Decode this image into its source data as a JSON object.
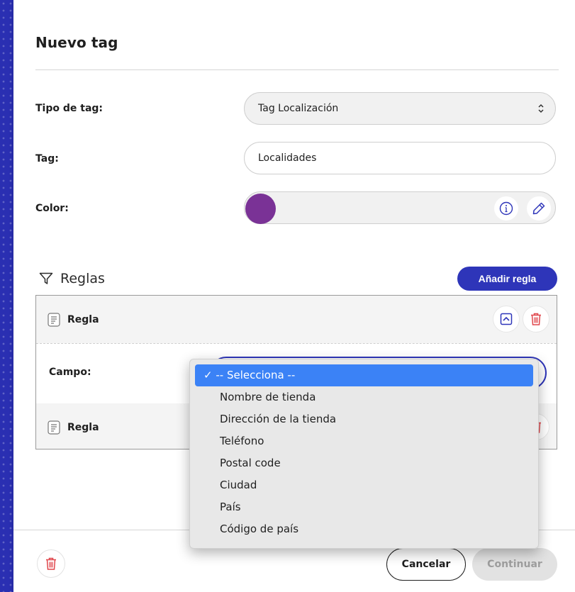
{
  "modal": {
    "title": "Nuevo tag"
  },
  "form": {
    "tipo_label": "Tipo de tag:",
    "tipo_value": "Tag Localización",
    "tag_label": "Tag:",
    "tag_value": "Localidades",
    "color_label": "Color:",
    "color_value": "#7a3296"
  },
  "rules": {
    "title": "Reglas",
    "add_button": "Añadir regla",
    "items": [
      {
        "label": "Regla",
        "field_label": "Campo:"
      },
      {
        "label": "Regla"
      }
    ]
  },
  "dropdown": {
    "options": [
      "-- Selecciona --",
      "Nombre de tienda",
      "Dirección de la tienda",
      "Teléfono",
      "Postal code",
      "Ciudad",
      "País",
      "Código de país"
    ],
    "selected_index": 0,
    "check_mark": "✓"
  },
  "footer": {
    "cancel": "Cancelar",
    "continue": "Continuar"
  },
  "colors": {
    "accent": "#2e35b9",
    "danger": "#e0474c",
    "selection": "#3b82f6"
  }
}
